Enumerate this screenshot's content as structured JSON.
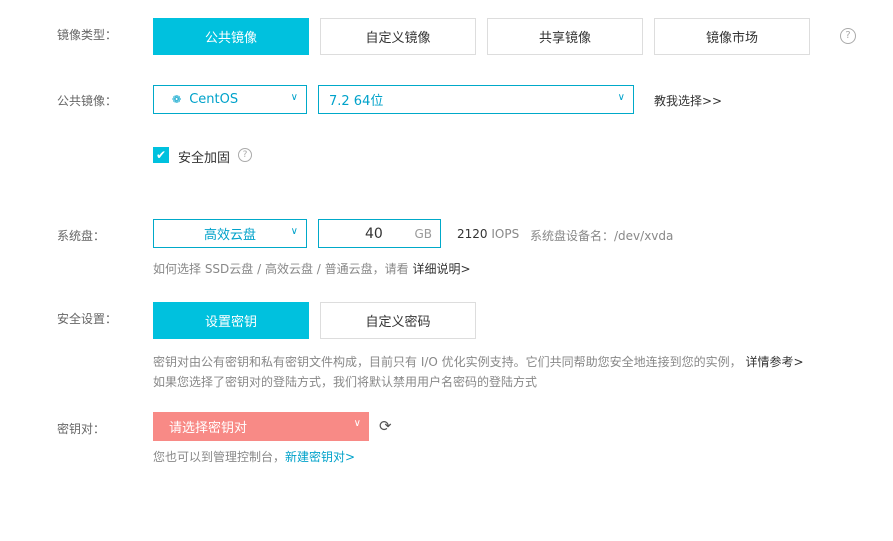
{
  "image_type": {
    "label": "镜像类型：",
    "options": [
      "公共镜像",
      "自定义镜像",
      "共享镜像",
      "镜像市场"
    ],
    "selected": "公共镜像",
    "help_icon": "question-circle-icon"
  },
  "public_image": {
    "label": "公共镜像：",
    "os": "CentOS",
    "os_icon": "centos-logo-icon",
    "version": "7.2 64位",
    "help_link": "教我选择>>"
  },
  "security_harden": {
    "label": "安全加固",
    "checked": true
  },
  "system_disk": {
    "label": "系统盘：",
    "type": "高效云盘",
    "size": "40",
    "unit": "GB",
    "iops_value": "2120",
    "iops_unit": "IOPS",
    "device": "系统盘设备名：/dev/xvda",
    "hint": "如何选择 SSD云盘 / 高效云盘 / 普通云盘，请看",
    "hint_link": "详细说明>"
  },
  "security": {
    "label": "安全设置：",
    "options": [
      "设置密钥",
      "自定义密码"
    ],
    "selected": "设置密钥",
    "desc1": "密钥对由公有密钥和私有密钥文件构成，目前只有 I/O 优化实例支持。它们共同帮助您安全地连接到您的实例，",
    "desc1_link": "详情参考>",
    "desc2": "如果您选择了密钥对的登陆方式，我们将默认禁用用户名密码的登陆方式"
  },
  "keypair": {
    "label": "密钥对：",
    "placeholder": "请选择密钥对",
    "hint": "您也可以到管理控制台，",
    "hint_link": "新建密钥对>"
  },
  "colors": {
    "accent": "#00c1de",
    "error": "#f88a86"
  }
}
